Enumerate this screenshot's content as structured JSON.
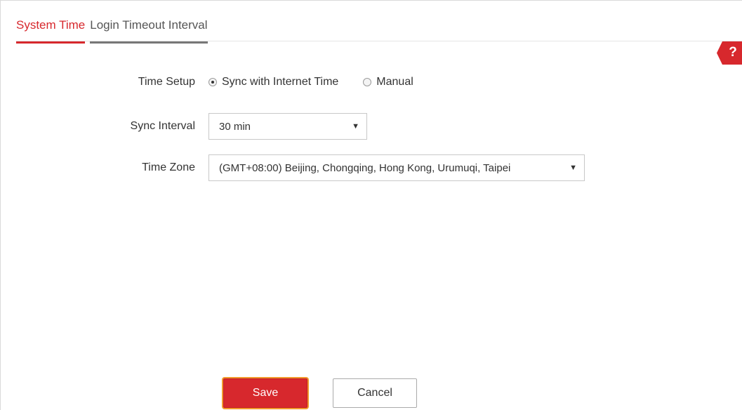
{
  "tabs": {
    "system_time": "System Time",
    "login_timeout": "Login Timeout Interval"
  },
  "help": {
    "symbol": "?"
  },
  "form": {
    "time_setup": {
      "label": "Time Setup",
      "options": [
        "Sync with Internet Time",
        "Manual"
      ],
      "selected": "Sync with Internet Time"
    },
    "sync_interval": {
      "label": "Sync Interval",
      "value": "30 min"
    },
    "time_zone": {
      "label": "Time Zone",
      "value": "(GMT+08:00) Beijing, Chongqing, Hong Kong, Urumuqi, Taipei"
    }
  },
  "buttons": {
    "save": "Save",
    "cancel": "Cancel"
  },
  "colors": {
    "accent": "#d7282d",
    "focus_outline": "#f39a2d"
  }
}
